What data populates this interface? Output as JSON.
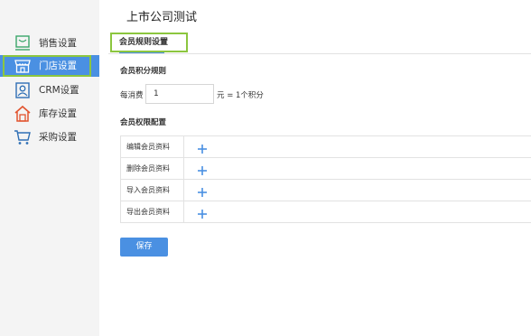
{
  "sidebar": {
    "items": [
      {
        "label": "销售设置",
        "icon": "monitor-icon"
      },
      {
        "label": "门店设置",
        "icon": "store-icon",
        "active": true
      },
      {
        "label": "CRM设置",
        "icon": "user-card-icon"
      },
      {
        "label": "库存设置",
        "icon": "warehouse-icon"
      },
      {
        "label": "采购设置",
        "icon": "cart-icon"
      }
    ]
  },
  "header": {
    "title": "上市公司测试"
  },
  "tabs": [
    {
      "label": "会员规则设置",
      "active": true
    }
  ],
  "points_rule": {
    "section_title": "会员积分规则",
    "prefix_label": "每消费",
    "input_value": "1",
    "suffix_label": "元 = 1个积分"
  },
  "permissions": {
    "section_title": "会员权限配置",
    "rows": [
      {
        "label": "编辑会员资料"
      },
      {
        "label": "删除会员资料"
      },
      {
        "label": "导入会员资料"
      },
      {
        "label": "导出会员资料"
      }
    ]
  },
  "actions": {
    "save_label": "保存"
  },
  "colors": {
    "accent": "#4a90e2",
    "highlight_outline": "#8cc63f",
    "sidebar_bg": "#f4f4f4"
  }
}
